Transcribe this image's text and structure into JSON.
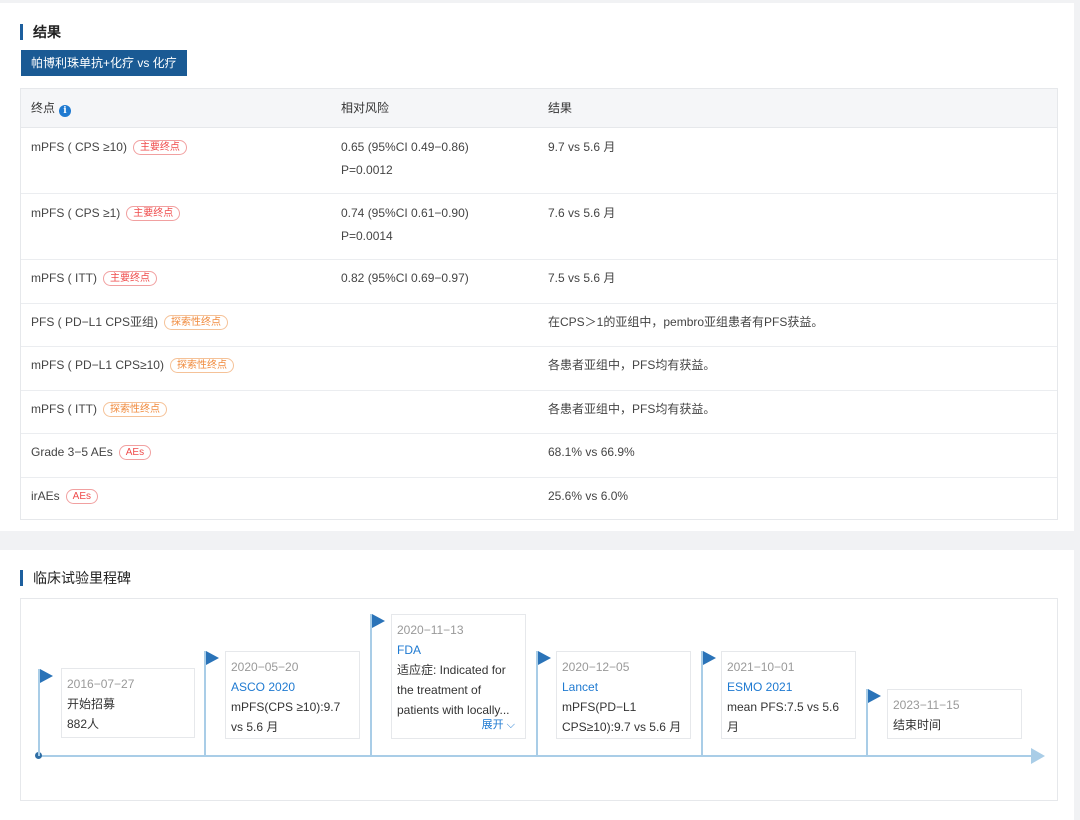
{
  "results": {
    "title": "结果",
    "tab": "帕博利珠单抗+化疗 vs 化疗",
    "headers": [
      "终点",
      "相对风险",
      "结果"
    ],
    "rows": [
      {
        "endpoint": "mPFS ( CPS ≥10)",
        "badge": "主要终点",
        "badge_type": "red",
        "risk_line1": "0.65 (95%CI 0.49−0.86)",
        "risk_line2": "P=0.0012",
        "result": "9.7 vs 5.6 月"
      },
      {
        "endpoint": "mPFS ( CPS ≥1)",
        "badge": "主要终点",
        "badge_type": "red",
        "risk_line1": "0.74 (95%CI 0.61−0.90)",
        "risk_line2": "P=0.0014",
        "result": "7.6 vs 5.6 月"
      },
      {
        "endpoint": "mPFS ( ITT)",
        "badge": "主要终点",
        "badge_type": "red",
        "risk_line1": "0.82 (95%CI 0.69−0.97)",
        "risk_line2": "",
        "result": "7.5 vs 5.6 月"
      },
      {
        "endpoint": "PFS ( PD−L1 CPS亚组)",
        "badge": "探索性终点",
        "badge_type": "orange",
        "risk_line1": "",
        "risk_line2": "",
        "result": "在CPS＞1的亚组中，pembro亚组患者有PFS获益。"
      },
      {
        "endpoint": "mPFS ( PD−L1 CPS≥10)",
        "badge": "探索性终点",
        "badge_type": "orange",
        "risk_line1": "",
        "risk_line2": "",
        "result": "各患者亚组中，PFS均有获益。"
      },
      {
        "endpoint": "mPFS ( ITT)",
        "badge": "探索性终点",
        "badge_type": "orange",
        "risk_line1": "",
        "risk_line2": "",
        "result": "各患者亚组中，PFS均有获益。"
      },
      {
        "endpoint": "Grade 3−5 AEs",
        "badge": "AEs",
        "badge_type": "red",
        "risk_line1": "",
        "risk_line2": "",
        "result": "68.1% vs 66.9%"
      },
      {
        "endpoint": "irAEs",
        "badge": "AEs",
        "badge_type": "red",
        "risk_line1": "",
        "risk_line2": "",
        "result": "25.6% vs 6.0%"
      }
    ]
  },
  "milestones": {
    "title": "临床试验里程碑",
    "items": [
      {
        "date": "2016−07−27",
        "source": "",
        "line1": "开始招募",
        "line2": "882人",
        "line3": ""
      },
      {
        "date": "2020−05−20",
        "source": "ASCO 2020",
        "line1": "mPFS(CPS ≥10):9.7",
        "line2": "vs 5.6 月",
        "line3": ""
      },
      {
        "date": "2020−11−13",
        "source": "FDA",
        "line1": "适应症: Indicated for",
        "line2": "the treatment of",
        "line3": "patients with locally...",
        "expand": "展开"
      },
      {
        "date": "2020−12−05",
        "source": "Lancet",
        "line1": "mPFS(PD−L1",
        "line2": "CPS≥10):9.7 vs 5.6 月",
        "line3": ""
      },
      {
        "date": "2021−10−01",
        "source": "ESMO 2021",
        "line1": "mean PFS:7.5 vs 5.6",
        "line2": "月",
        "line3": ""
      },
      {
        "date": "2023−11−15",
        "source": "",
        "line1": "结束时间",
        "line2": "",
        "line3": ""
      }
    ]
  }
}
